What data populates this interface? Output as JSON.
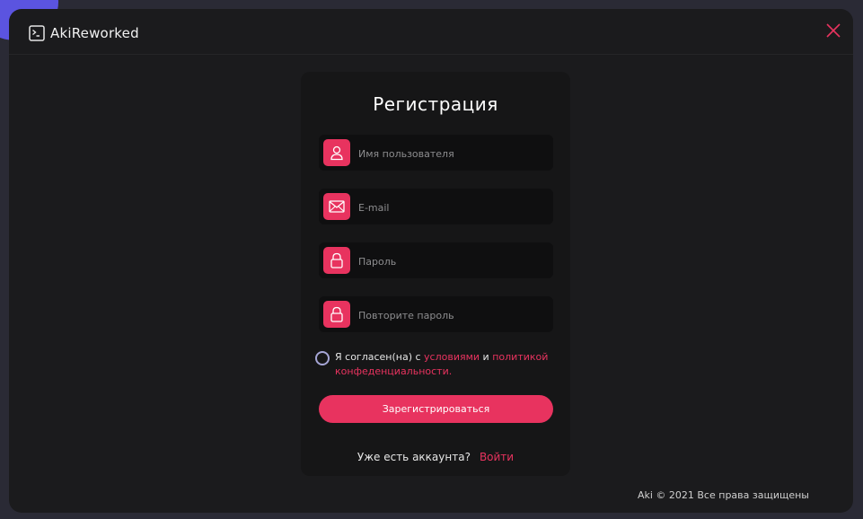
{
  "app": {
    "title": "AkiReworked",
    "icon": "terminal-icon",
    "close_icon": "close-icon"
  },
  "form": {
    "title": "Регистрация",
    "fields": [
      {
        "placeholder": "Имя пользователя",
        "value": "",
        "icon": "user-icon"
      },
      {
        "placeholder": "E-mail",
        "value": "",
        "icon": "mail-icon"
      },
      {
        "placeholder": "Пароль",
        "value": "",
        "icon": "lock-icon"
      },
      {
        "placeholder": "Повторите пароль",
        "value": "",
        "icon": "lock-icon"
      }
    ],
    "agree": {
      "prefix": "Я согласен(на) с ",
      "terms_link": "условиями",
      "middle": " и ",
      "privacy_link": "политикой конфеденциальности."
    },
    "submit_label": "Зарегистрироваться",
    "login_prompt": "Уже есть аккаунта?",
    "login_link": "Войти"
  },
  "footer": {
    "text": "Aki © 2021 Все права защищены"
  },
  "colors": {
    "accent": "#e8335f",
    "background": "#1b1b1d",
    "card": "#161617",
    "outer": "#2a2a35",
    "blob": "#5b54e0"
  }
}
